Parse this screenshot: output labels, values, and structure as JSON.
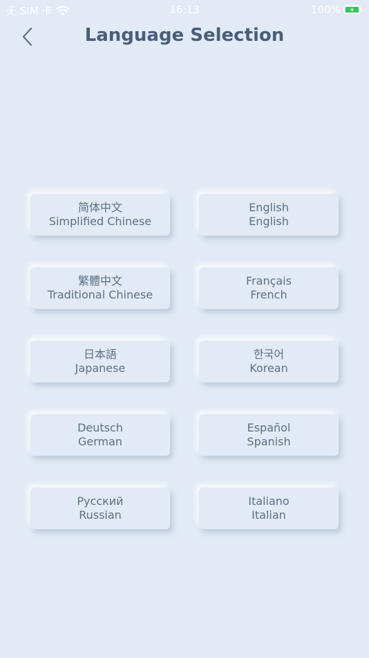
{
  "status_bar": {
    "carrier": "无 SIM 卡",
    "time": "16:13",
    "battery": "100%"
  },
  "nav": {
    "title": "Language Selection"
  },
  "languages": [
    {
      "native": "简体中文",
      "english": "Simplified Chinese"
    },
    {
      "native": "English",
      "english": "English"
    },
    {
      "native": "繁體中文",
      "english": "Traditional Chinese"
    },
    {
      "native": "Français",
      "english": "French"
    },
    {
      "native": "日本語",
      "english": "Japanese"
    },
    {
      "native": "한국어",
      "english": "Korean"
    },
    {
      "native": "Deutsch",
      "english": "German"
    },
    {
      "native": "Español",
      "english": "Spanish"
    },
    {
      "native": "Русский",
      "english": "Russian"
    },
    {
      "native": "Italiano",
      "english": "Italian"
    }
  ],
  "colors": {
    "background": "#e1eaf5",
    "title": "#4a5e78",
    "button_text": "#5f6f83",
    "battery_fill": "#34c759"
  }
}
